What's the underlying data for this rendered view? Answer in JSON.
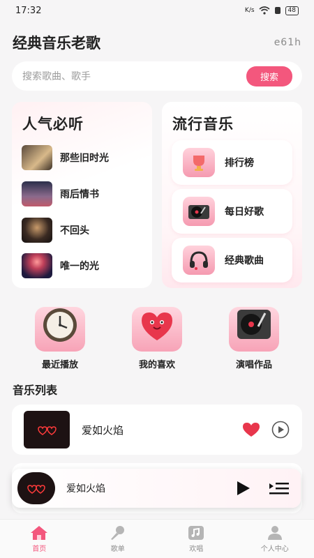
{
  "status": {
    "time": "17:32",
    "net_speed": "K/s",
    "battery": "48"
  },
  "header": {
    "title": "经典音乐老歌",
    "code": "e61h"
  },
  "search": {
    "placeholder": "搜索歌曲、歌手",
    "button": "搜索"
  },
  "popular": {
    "title": "人气必听",
    "items": [
      {
        "label": "那些旧时光"
      },
      {
        "label": "雨后情书"
      },
      {
        "label": "不回头"
      },
      {
        "label": "唯一的光"
      }
    ]
  },
  "trending": {
    "title": "流行音乐",
    "items": [
      {
        "label": "排行榜",
        "icon": "trophy-icon"
      },
      {
        "label": "每日好歌",
        "icon": "record-player-icon"
      },
      {
        "label": "经典歌曲",
        "icon": "headphones-icon"
      }
    ]
  },
  "quick_actions": [
    {
      "label": "最近播放",
      "icon": "clock-icon"
    },
    {
      "label": "我的喜欢",
      "icon": "heart-icon"
    },
    {
      "label": "演唱作品",
      "icon": "turntable-icon"
    }
  ],
  "music_list": {
    "title": "音乐列表",
    "tracks": [
      {
        "title": "爱如火焰"
      }
    ]
  },
  "mini_player": {
    "title": "爱如火焰"
  },
  "tabbar": [
    {
      "label": "首页",
      "icon": "home-icon",
      "active": true
    },
    {
      "label": "歌单",
      "icon": "microphone-icon",
      "active": false
    },
    {
      "label": "欢唱",
      "icon": "music-note-icon",
      "active": false
    },
    {
      "label": "个人中心",
      "icon": "user-icon",
      "active": false
    }
  ],
  "colors": {
    "accent": "#f3577d",
    "heart": "#e8364c"
  }
}
